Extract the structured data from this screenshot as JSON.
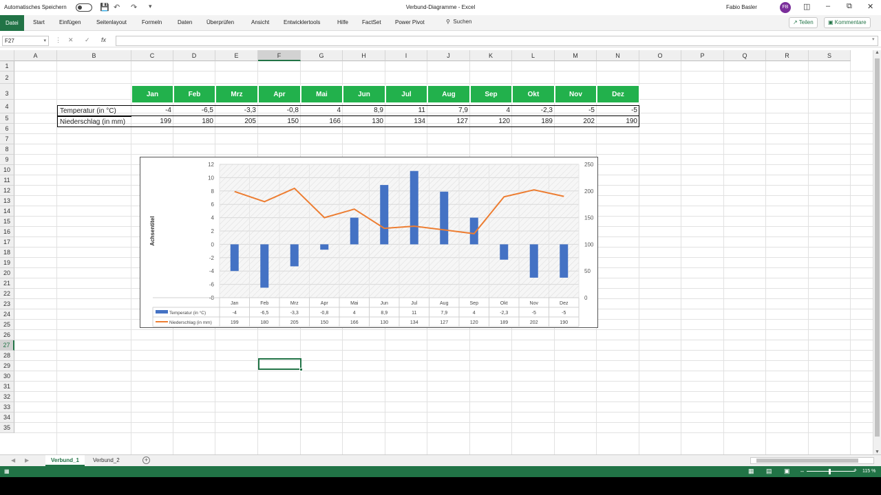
{
  "titlebar": {
    "autosave_label": "Automatisches Speichern",
    "autosave_state": "off",
    "window_title": "Verbund-Diagramme  -  Excel",
    "user_name": "Fabio Basler",
    "user_initials": "FB"
  },
  "ribbon": {
    "tabs": [
      "Datei",
      "Start",
      "Einfügen",
      "Seitenlayout",
      "Formeln",
      "Daten",
      "Überprüfen",
      "Ansicht",
      "Entwicklertools",
      "Hilfe",
      "FactSet",
      "Power Pivot"
    ],
    "active_tab": "Datei",
    "search_label": "Suchen",
    "share_label": "Teilen",
    "comments_label": "Kommentare"
  },
  "formula_bar": {
    "name_box": "F27",
    "formula": ""
  },
  "grid": {
    "columns": [
      "A",
      "B",
      "C",
      "D",
      "E",
      "F",
      "G",
      "H",
      "I",
      "J",
      "K",
      "L",
      "M",
      "N",
      "O",
      "P",
      "Q",
      "R",
      "S"
    ],
    "selected_column": "F",
    "rows": [
      "1",
      "2",
      "3",
      "4",
      "5",
      "6",
      "7",
      "8",
      "9",
      "10",
      "11",
      "12",
      "13",
      "14",
      "15",
      "16",
      "17",
      "18",
      "19",
      "20",
      "21",
      "22",
      "23",
      "24",
      "25",
      "26",
      "27",
      "28",
      "29",
      "30",
      "31",
      "32",
      "33",
      "34",
      "35"
    ],
    "selected_row": "27"
  },
  "table": {
    "months": [
      "Jan",
      "Feb",
      "Mrz",
      "Apr",
      "Mai",
      "Jun",
      "Jul",
      "Aug",
      "Sep",
      "Okt",
      "Nov",
      "Dez"
    ],
    "temp_label": "Temperatur (in °C)",
    "temp_values": [
      "-4",
      "-6,5",
      "-3,3",
      "-0,8",
      "4",
      "8,9",
      "11",
      "7,9",
      "4",
      "-2,3",
      "-5",
      "-5"
    ],
    "precip_label": "Niederschlag (in mm)",
    "precip_values": [
      "199",
      "180",
      "205",
      "150",
      "166",
      "130",
      "134",
      "127",
      "120",
      "189",
      "202",
      "190"
    ]
  },
  "chart_data": {
    "type": "bar",
    "categories": [
      "Jan",
      "Feb",
      "Mrz",
      "Apr",
      "Mai",
      "Jun",
      "Jul",
      "Aug",
      "Sep",
      "Okt",
      "Nov",
      "Dez"
    ],
    "series": [
      {
        "name": "Temperatur (in °C)",
        "type": "bar",
        "axis": "primary",
        "color": "#4472c4",
        "values": [
          -4,
          -6.5,
          -3.3,
          -0.8,
          4,
          8.9,
          11,
          7.9,
          4,
          -2.3,
          -5,
          -5
        ]
      },
      {
        "name": "Niederschlag (in mm)",
        "type": "line",
        "axis": "secondary",
        "color": "#ed7d31",
        "values": [
          199,
          180,
          205,
          150,
          166,
          130,
          134,
          127,
          120,
          189,
          202,
          190
        ]
      }
    ],
    "ylabel": "Achsentitel",
    "ylim": [
      -8,
      12
    ],
    "yticks": [
      -8,
      -6,
      -4,
      -2,
      0,
      2,
      4,
      6,
      8,
      10,
      12
    ],
    "y2lim": [
      0,
      250
    ],
    "y2ticks": [
      0,
      50,
      100,
      150,
      200,
      250
    ],
    "data_table": true,
    "data_table_values": {
      "Temperatur (in °C)": [
        "-4",
        "-6,5",
        "-3,3",
        "-0,8",
        "4",
        "8,9",
        "11",
        "7,9",
        "4",
        "-2,3",
        "-5",
        "-5"
      ],
      "Niederschlag (in mm)": [
        "199",
        "180",
        "205",
        "150",
        "166",
        "130",
        "134",
        "127",
        "120",
        "189",
        "202",
        "190"
      ]
    },
    "plot_fill": "hatched"
  },
  "sheets": {
    "tabs": [
      "Verbund_1",
      "Verbund_2"
    ],
    "active": "Verbund_1"
  },
  "status": {
    "zoom": "115 %"
  },
  "colors": {
    "excel_green": "#217346",
    "header_green": "#22b14c",
    "bar_blue": "#4472c4",
    "line_orange": "#ed7d31"
  }
}
